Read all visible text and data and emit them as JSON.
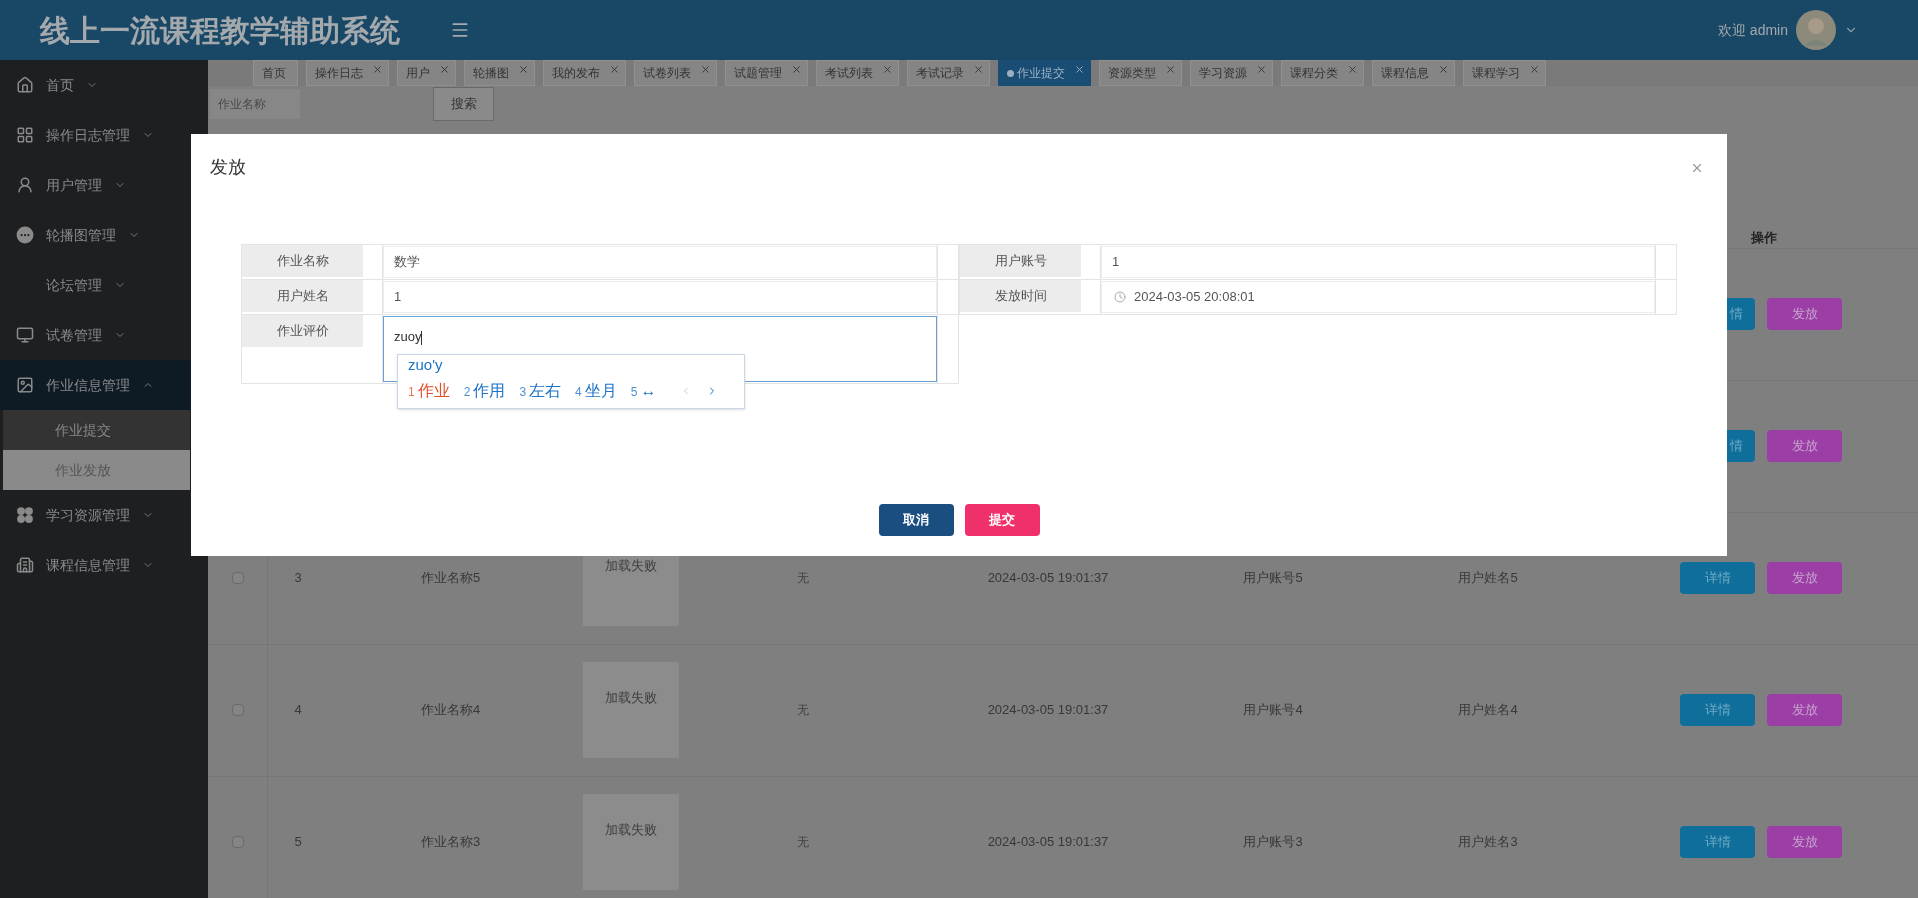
{
  "app_title": "线上一流课程教学辅助系统",
  "user": {
    "greeting": "欢迎 admin"
  },
  "sidebar": {
    "items": [
      {
        "label": "首页",
        "expanded": false
      },
      {
        "label": "操作日志管理",
        "expanded": false
      },
      {
        "label": "用户管理",
        "expanded": false
      },
      {
        "label": "轮播图管理",
        "expanded": false
      },
      {
        "label": "论坛管理",
        "expanded": false
      },
      {
        "label": "试卷管理",
        "expanded": false
      },
      {
        "label": "作业信息管理",
        "expanded": true,
        "children": [
          {
            "label": "作业提交",
            "selected": false
          },
          {
            "label": "作业发放",
            "selected": true
          }
        ]
      },
      {
        "label": "学习资源管理",
        "expanded": false
      },
      {
        "label": "课程信息管理",
        "expanded": false
      }
    ]
  },
  "tabs": [
    {
      "label": "首页",
      "selected": false,
      "closable": false
    },
    {
      "label": "操作日志",
      "selected": false,
      "closable": true
    },
    {
      "label": "用户",
      "selected": false,
      "closable": true
    },
    {
      "label": "轮播图",
      "selected": false,
      "closable": true
    },
    {
      "label": "我的发布",
      "selected": false,
      "closable": true
    },
    {
      "label": "试卷列表",
      "selected": false,
      "closable": true
    },
    {
      "label": "试题管理",
      "selected": false,
      "closable": true
    },
    {
      "label": "考试列表",
      "selected": false,
      "closable": true
    },
    {
      "label": "考试记录",
      "selected": false,
      "closable": true
    },
    {
      "label": "作业提交",
      "selected": true,
      "closable": true
    },
    {
      "label": "资源类型",
      "selected": false,
      "closable": true
    },
    {
      "label": "学习资源",
      "selected": false,
      "closable": true
    },
    {
      "label": "课程分类",
      "selected": false,
      "closable": true
    },
    {
      "label": "课程信息",
      "selected": false,
      "closable": true
    },
    {
      "label": "课程学习",
      "selected": false,
      "closable": true
    }
  ],
  "search": {
    "placeholder": "作业名称",
    "button": "搜索"
  },
  "table": {
    "actions_header": "操作",
    "rows": [
      {
        "actions": [
          "情",
          "发放"
        ]
      },
      {
        "actions": [
          "情",
          "发放"
        ]
      },
      {
        "checked": false,
        "index": "3",
        "name": "作业名称5",
        "image": "加载失败",
        "remark": "无",
        "time": "2024-03-05 19:01:37",
        "account": "用户账号5",
        "username": "用户姓名5",
        "actions": [
          "详情",
          "发放"
        ]
      },
      {
        "checked": false,
        "index": "4",
        "name": "作业名称4",
        "image": "加载失败",
        "remark": "无",
        "time": "2024-03-05 19:01:37",
        "account": "用户账号4",
        "username": "用户姓名4",
        "actions": [
          "详情",
          "发放"
        ]
      },
      {
        "checked": false,
        "index": "5",
        "name": "作业名称3",
        "image": "加载失败",
        "remark": "无",
        "time": "2024-03-05 19:01:37",
        "account": "用户账号3",
        "username": "用户姓名3",
        "actions": [
          "详情",
          "发放"
        ]
      }
    ]
  },
  "dialog": {
    "title": "发放",
    "fields": [
      {
        "label": "作业名称",
        "value": "数学",
        "kind": "text"
      },
      {
        "label": "用户账号",
        "value": "1",
        "kind": "text"
      },
      {
        "label": "用户姓名",
        "value": "1",
        "kind": "text"
      },
      {
        "label": "发放时间",
        "value": "2024-03-05 20:08:01",
        "kind": "datetime"
      },
      {
        "label": "作业评价",
        "value": "zuoy",
        "kind": "textarea"
      }
    ],
    "ime": {
      "composition": "zuo'y",
      "candidates": [
        {
          "number": "1",
          "text": "作业",
          "selected": true
        },
        {
          "number": "2",
          "text": "作用",
          "selected": false
        },
        {
          "number": "3",
          "text": "左右",
          "selected": false
        },
        {
          "number": "4",
          "text": "坐月",
          "selected": false
        },
        {
          "number": "5",
          "text": "↔",
          "selected": false
        }
      ]
    },
    "buttons": [
      {
        "label": "取消",
        "kind": "cancel"
      },
      {
        "label": "提交",
        "kind": "submit"
      }
    ]
  }
}
